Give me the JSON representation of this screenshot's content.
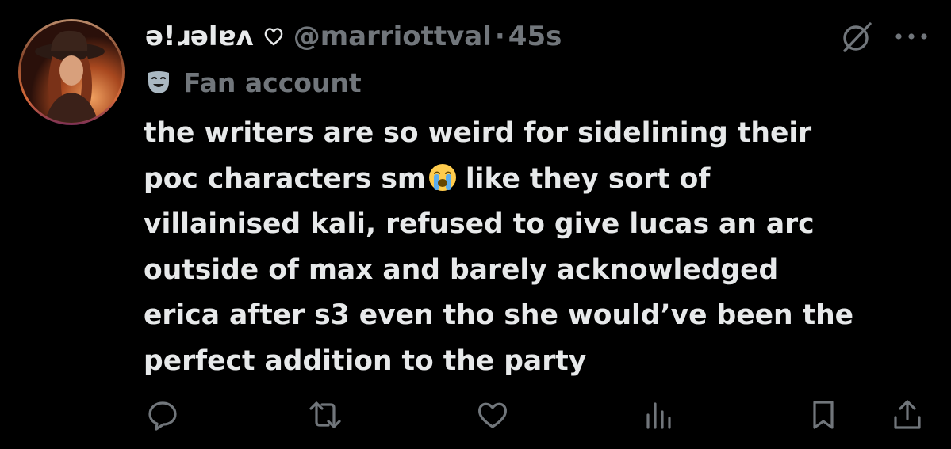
{
  "author": {
    "display_name": "ǝ!ɹǝlɐʌ",
    "handle": "@marriottval",
    "separator": "·",
    "time": "45s",
    "label": "Fan account"
  },
  "tweet": {
    "lines": [
      "the writers are so weird for sidelining their",
      "poc characters sm",
      "like they sort of",
      "villainised kali, refused to give lucas an arc",
      "outside of max and barely acknowledged",
      "erica after s3 even tho she would’ve been the",
      "perfect addition to the party"
    ]
  },
  "icons": {
    "name_flag": "sparkle-heart-icon",
    "label_badge": "theater-mask-icon",
    "emoji": "loudly-crying-face-emoji",
    "top_right": [
      "grok-icon",
      "more-icon"
    ],
    "actions": [
      "reply-icon",
      "retweet-icon",
      "like-icon",
      "views-icon",
      "bookmark-icon",
      "share-icon"
    ]
  },
  "colors": {
    "background": "#000000",
    "primary_text": "#e7e9ea",
    "secondary_text": "#71767b"
  }
}
